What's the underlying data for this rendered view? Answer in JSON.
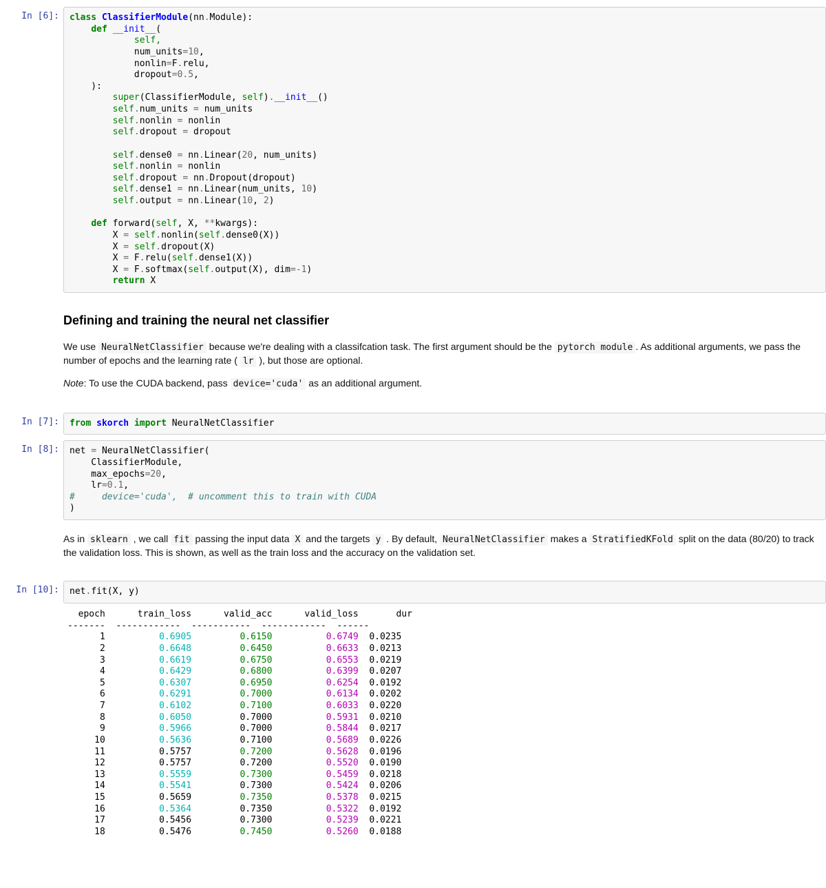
{
  "cells": {
    "c6": {
      "prompt": "In [6]:"
    },
    "c7": {
      "prompt": "In [7]:"
    },
    "c8": {
      "prompt": "In [8]:"
    },
    "c10": {
      "prompt": "In [10]:"
    }
  },
  "md1": {
    "heading": "Defining and training the neural net classifier",
    "p1_a": "We use ",
    "p1_code1": "NeuralNetClassifier",
    "p1_b": " because we're dealing with a classifcation task. The first argument should be the ",
    "p1_code2": "pytorch module",
    "p1_c": ". As additional arguments, we pass the number of epochs and the learning rate ( ",
    "p1_code3": "lr",
    "p1_d": " ), but those are optional.",
    "p2_note": "Note",
    "p2_a": ": To use the CUDA backend, pass ",
    "p2_code": "device='cuda'",
    "p2_b": " as an additional argument."
  },
  "md2": {
    "a": "As in ",
    "code1": "sklearn",
    "b": " , we call ",
    "code2": "fit",
    "c": " passing the input data ",
    "code3": "X",
    "d": " and the targets ",
    "code4": "y",
    "e": " . By default, ",
    "code5": "NeuralNetClassifier",
    "f": " makes a ",
    "code6": "StratifiedKFold",
    "g": " split on the data (80/20) to track the validation loss. This is shown, as well as the train loss and the accuracy on the validation set."
  },
  "code6": {
    "l1_1": "class",
    "l1_2": " ",
    "l1_3": "ClassifierModule",
    "l1_4": "(nn",
    "l1_5": ".",
    "l1_6": "Module):",
    "l2_1": "    ",
    "l2_2": "def",
    "l2_3": " ",
    "l2_4": "__init__",
    "l2_5": "(",
    "l3": "            self,",
    "l4_1": "            num_units",
    "l4_2": "=",
    "l4_3": "10",
    "l4_4": ",",
    "l5_1": "            nonlin",
    "l5_2": "=",
    "l5_3": "F",
    "l5_4": ".",
    "l5_5": "relu,",
    "l6_1": "            dropout",
    "l6_2": "=",
    "l6_3": "0.5",
    "l6_4": ",",
    "l7": "    ):",
    "l8_1": "        ",
    "l8_2": "super",
    "l8_3": "(ClassifierModule, ",
    "l8_4": "self",
    "l8_5": ")",
    "l8_6": ".",
    "l8_7": "__init__",
    "l8_8": "()",
    "l9_1": "        ",
    "l9_2": "self",
    "l9_3": ".",
    "l9_4": "num_units ",
    "l9_5": "=",
    "l9_6": " num_units",
    "l10_1": "        ",
    "l10_2": "self",
    "l10_3": ".",
    "l10_4": "nonlin ",
    "l10_5": "=",
    "l10_6": " nonlin",
    "l11_1": "        ",
    "l11_2": "self",
    "l11_3": ".",
    "l11_4": "dropout ",
    "l11_5": "=",
    "l11_6": " dropout",
    "l12": "",
    "l13_1": "        ",
    "l13_2": "self",
    "l13_3": ".",
    "l13_4": "dense0 ",
    "l13_5": "=",
    "l13_6": " nn",
    "l13_7": ".",
    "l13_8": "Linear(",
    "l13_9": "20",
    "l13_10": ", num_units)",
    "l14_1": "        ",
    "l14_2": "self",
    "l14_3": ".",
    "l14_4": "nonlin ",
    "l14_5": "=",
    "l14_6": " nonlin",
    "l15_1": "        ",
    "l15_2": "self",
    "l15_3": ".",
    "l15_4": "dropout ",
    "l15_5": "=",
    "l15_6": " nn",
    "l15_7": ".",
    "l15_8": "Dropout(dropout)",
    "l16_1": "        ",
    "l16_2": "self",
    "l16_3": ".",
    "l16_4": "dense1 ",
    "l16_5": "=",
    "l16_6": " nn",
    "l16_7": ".",
    "l16_8": "Linear(num_units, ",
    "l16_9": "10",
    "l16_10": ")",
    "l17_1": "        ",
    "l17_2": "self",
    "l17_3": ".",
    "l17_4": "output ",
    "l17_5": "=",
    "l17_6": " nn",
    "l17_7": ".",
    "l17_8": "Linear(",
    "l17_9": "10",
    "l17_10": ", ",
    "l17_11": "2",
    "l17_12": ")",
    "l18": "",
    "l19_1": "    ",
    "l19_2": "def",
    "l19_3": " ",
    "l19_4": "forward",
    "l19_5": "(",
    "l19_6": "self",
    "l19_7": ", X, ",
    "l19_8": "**",
    "l19_9": "kwargs):",
    "l20_1": "        X ",
    "l20_2": "=",
    "l20_3": " ",
    "l20_4": "self",
    "l20_5": ".",
    "l20_6": "nonlin(",
    "l20_7": "self",
    "l20_8": ".",
    "l20_9": "dense0(X))",
    "l21_1": "        X ",
    "l21_2": "=",
    "l21_3": " ",
    "l21_4": "self",
    "l21_5": ".",
    "l21_6": "dropout(X)",
    "l22_1": "        X ",
    "l22_2": "=",
    "l22_3": " F",
    "l22_4": ".",
    "l22_5": "relu(",
    "l22_6": "self",
    "l22_7": ".",
    "l22_8": "dense1(X))",
    "l23_1": "        X ",
    "l23_2": "=",
    "l23_3": " F",
    "l23_4": ".",
    "l23_5": "softmax(",
    "l23_6": "self",
    "l23_7": ".",
    "l23_8": "output(X), dim",
    "l23_9": "=-",
    "l23_10": "1",
    "l23_11": ")",
    "l24_1": "        ",
    "l24_2": "return",
    "l24_3": " X"
  },
  "code7": {
    "l1_1": "from",
    "l1_2": " ",
    "l1_3": "skorch",
    "l1_4": " ",
    "l1_5": "import",
    "l1_6": " NeuralNetClassifier"
  },
  "code8": {
    "l1_1": "net ",
    "l1_2": "=",
    "l1_3": " NeuralNetClassifier(",
    "l2": "    ClassifierModule,",
    "l3_1": "    max_epochs",
    "l3_2": "=",
    "l3_3": "20",
    "l3_4": ",",
    "l4_1": "    lr",
    "l4_2": "=",
    "l4_3": "0.1",
    "l4_4": ",",
    "l5": "#     device='cuda',  # uncomment this to train with CUDA",
    "l6": ")"
  },
  "code10": {
    "l1_1": "net",
    "l1_2": ".",
    "l1_3": "fit(X, y)"
  },
  "out10": {
    "header": {
      "epoch": "epoch",
      "train_loss": "train_loss",
      "valid_acc": "valid_acc",
      "valid_loss": "valid_loss",
      "dur": "dur"
    },
    "dashes": {
      "epoch": "-------",
      "train_loss": "------------",
      "valid_acc": "-----------",
      "valid_loss": "------------",
      "dur": "------"
    },
    "rows": [
      {
        "epoch": 1,
        "train_loss": "0.6905",
        "valid_acc": "0.6150",
        "valid_loss": "0.6749",
        "dur": "0.0235",
        "tl_hi": true,
        "va_hi": true
      },
      {
        "epoch": 2,
        "train_loss": "0.6648",
        "valid_acc": "0.6450",
        "valid_loss": "0.6633",
        "dur": "0.0213",
        "tl_hi": true,
        "va_hi": true
      },
      {
        "epoch": 3,
        "train_loss": "0.6619",
        "valid_acc": "0.6750",
        "valid_loss": "0.6553",
        "dur": "0.0219",
        "tl_hi": true,
        "va_hi": true
      },
      {
        "epoch": 4,
        "train_loss": "0.6429",
        "valid_acc": "0.6800",
        "valid_loss": "0.6399",
        "dur": "0.0207",
        "tl_hi": true,
        "va_hi": true
      },
      {
        "epoch": 5,
        "train_loss": "0.6307",
        "valid_acc": "0.6950",
        "valid_loss": "0.6254",
        "dur": "0.0192",
        "tl_hi": true,
        "va_hi": true
      },
      {
        "epoch": 6,
        "train_loss": "0.6291",
        "valid_acc": "0.7000",
        "valid_loss": "0.6134",
        "dur": "0.0202",
        "tl_hi": true,
        "va_hi": true
      },
      {
        "epoch": 7,
        "train_loss": "0.6102",
        "valid_acc": "0.7100",
        "valid_loss": "0.6033",
        "dur": "0.0220",
        "tl_hi": true,
        "va_hi": true
      },
      {
        "epoch": 8,
        "train_loss": "0.6050",
        "valid_acc": "0.7000",
        "valid_loss": "0.5931",
        "dur": "0.0210",
        "tl_hi": true,
        "va_hi": false
      },
      {
        "epoch": 9,
        "train_loss": "0.5966",
        "valid_acc": "0.7000",
        "valid_loss": "0.5844",
        "dur": "0.0217",
        "tl_hi": true,
        "va_hi": false
      },
      {
        "epoch": 10,
        "train_loss": "0.5636",
        "valid_acc": "0.7100",
        "valid_loss": "0.5689",
        "dur": "0.0226",
        "tl_hi": true,
        "va_hi": false
      },
      {
        "epoch": 11,
        "train_loss": "0.5757",
        "valid_acc": "0.7200",
        "valid_loss": "0.5628",
        "dur": "0.0196",
        "tl_hi": false,
        "va_hi": true
      },
      {
        "epoch": 12,
        "train_loss": "0.5757",
        "valid_acc": "0.7200",
        "valid_loss": "0.5520",
        "dur": "0.0190",
        "tl_hi": false,
        "va_hi": false
      },
      {
        "epoch": 13,
        "train_loss": "0.5559",
        "valid_acc": "0.7300",
        "valid_loss": "0.5459",
        "dur": "0.0218",
        "tl_hi": true,
        "va_hi": true
      },
      {
        "epoch": 14,
        "train_loss": "0.5541",
        "valid_acc": "0.7300",
        "valid_loss": "0.5424",
        "dur": "0.0206",
        "tl_hi": true,
        "va_hi": false
      },
      {
        "epoch": 15,
        "train_loss": "0.5659",
        "valid_acc": "0.7350",
        "valid_loss": "0.5378",
        "dur": "0.0215",
        "tl_hi": false,
        "va_hi": true
      },
      {
        "epoch": 16,
        "train_loss": "0.5364",
        "valid_acc": "0.7350",
        "valid_loss": "0.5322",
        "dur": "0.0192",
        "tl_hi": true,
        "va_hi": false
      },
      {
        "epoch": 17,
        "train_loss": "0.5456",
        "valid_acc": "0.7300",
        "valid_loss": "0.5239",
        "dur": "0.0221",
        "tl_hi": false,
        "va_hi": false
      },
      {
        "epoch": 18,
        "train_loss": "0.5476",
        "valid_acc": "0.7450",
        "valid_loss": "0.5260",
        "dur": "0.0188",
        "tl_hi": false,
        "va_hi": true
      }
    ]
  },
  "chart_data": {
    "type": "table",
    "title": "Training log (NeuralNetClassifier.fit)",
    "columns": [
      "epoch",
      "train_loss",
      "valid_acc",
      "valid_loss",
      "dur"
    ],
    "rows": [
      [
        1,
        0.6905,
        0.615,
        0.6749,
        0.0235
      ],
      [
        2,
        0.6648,
        0.645,
        0.6633,
        0.0213
      ],
      [
        3,
        0.6619,
        0.675,
        0.6553,
        0.0219
      ],
      [
        4,
        0.6429,
        0.68,
        0.6399,
        0.0207
      ],
      [
        5,
        0.6307,
        0.695,
        0.6254,
        0.0192
      ],
      [
        6,
        0.6291,
        0.7,
        0.6134,
        0.0202
      ],
      [
        7,
        0.6102,
        0.71,
        0.6033,
        0.022
      ],
      [
        8,
        0.605,
        0.7,
        0.5931,
        0.021
      ],
      [
        9,
        0.5966,
        0.7,
        0.5844,
        0.0217
      ],
      [
        10,
        0.5636,
        0.71,
        0.5689,
        0.0226
      ],
      [
        11,
        0.5757,
        0.72,
        0.5628,
        0.0196
      ],
      [
        12,
        0.5757,
        0.72,
        0.552,
        0.019
      ],
      [
        13,
        0.5559,
        0.73,
        0.5459,
        0.0218
      ],
      [
        14,
        0.5541,
        0.73,
        0.5424,
        0.0206
      ],
      [
        15,
        0.5659,
        0.735,
        0.5378,
        0.0215
      ],
      [
        16,
        0.5364,
        0.735,
        0.5322,
        0.0192
      ],
      [
        17,
        0.5456,
        0.73,
        0.5239,
        0.0221
      ],
      [
        18,
        0.5476,
        0.745,
        0.526,
        0.0188
      ]
    ]
  }
}
